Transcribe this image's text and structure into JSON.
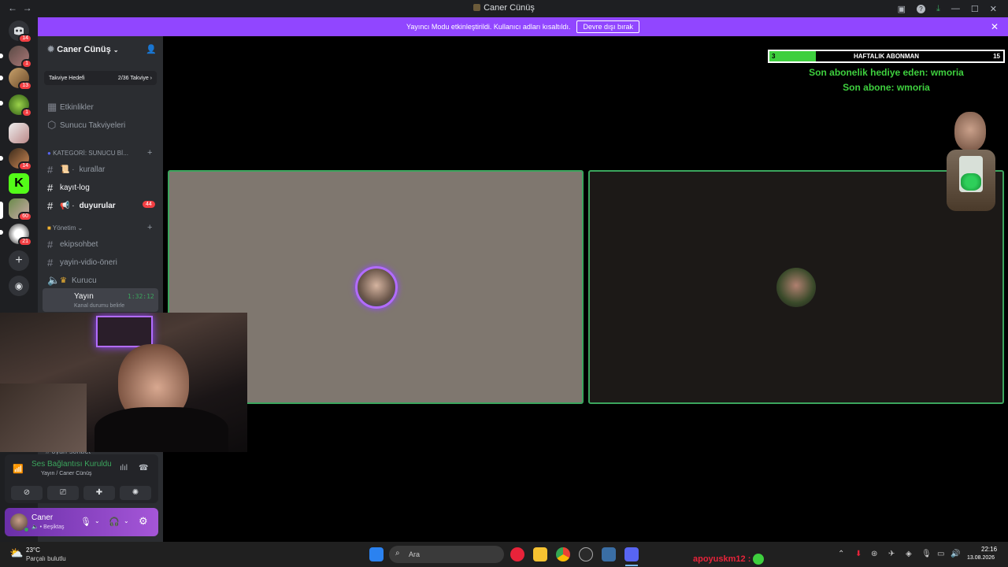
{
  "titlebar": {
    "title": "Caner Cünüş",
    "back": "←",
    "forward": "→"
  },
  "banner": {
    "message": "Yayıncı Modu etkinleştirildi. Kullanıcı adları kısaltıldı.",
    "button_label": "Devre dışı bırak",
    "accent": "#9146ff"
  },
  "rail": {
    "badges": [
      "14",
      "1",
      "13",
      "1",
      "14",
      "60",
      "21"
    ]
  },
  "sidebar": {
    "server_name": "Caner Cünüş",
    "boost_label": "Takviye Hedefi",
    "boost_count": "2/36 Takviye",
    "items": [
      {
        "label": "Etkinlikler",
        "icon": "calendar-icon"
      },
      {
        "label": "Sunucu Takviyeleri",
        "icon": "boost-icon"
      }
    ],
    "category1": "KATEGORİ: SUNUCU Bİ...",
    "channels1": [
      {
        "label": "kurallar",
        "prefix": "📜 ·"
      },
      {
        "label": "kayıt-log",
        "prefix": ""
      },
      {
        "label": "duyurular",
        "prefix": "📢 ·",
        "badge": "44"
      }
    ],
    "category2": "Yönetim",
    "channels2": [
      {
        "label": "ekipsohbet"
      },
      {
        "label": "yayin-vidio-öneri"
      }
    ],
    "voice_kurucu": "Kurucu",
    "voice_yayin": "Yayın",
    "voice_time": "1:32:12",
    "voice_status": "Kanal durumu belirle",
    "hidden_channel": "oyun-sohbet"
  },
  "voice_panel": {
    "status": "Ses Bağlantısı Kuruldu",
    "location": "Yayın / Caner Cünüş"
  },
  "user_panel": {
    "name": "Caner",
    "status": "Beşiktaş"
  },
  "overlay": {
    "sub_goal_title": "HAFTALIK ABONMAN",
    "sub_current": "3",
    "sub_target": "15",
    "sub_progress": 0.2,
    "gift_line": "Son abonelik hediye eden: wmoria",
    "last_sub_line": "Son abone: wmoria"
  },
  "taskbar": {
    "weather_temp": "23°C",
    "weather_desc": "Parçalı bulutlu",
    "search_placeholder": "Ara",
    "chat_user": "apoyuskm12 :",
    "time": "22:16",
    "date": "13.08.2026"
  },
  "colors": {
    "speaking_border": "#3ba55d",
    "badge_red": "#f23f43",
    "overlay_green": "#3ecf3e",
    "sidebar_bg": "#2b2d31"
  }
}
